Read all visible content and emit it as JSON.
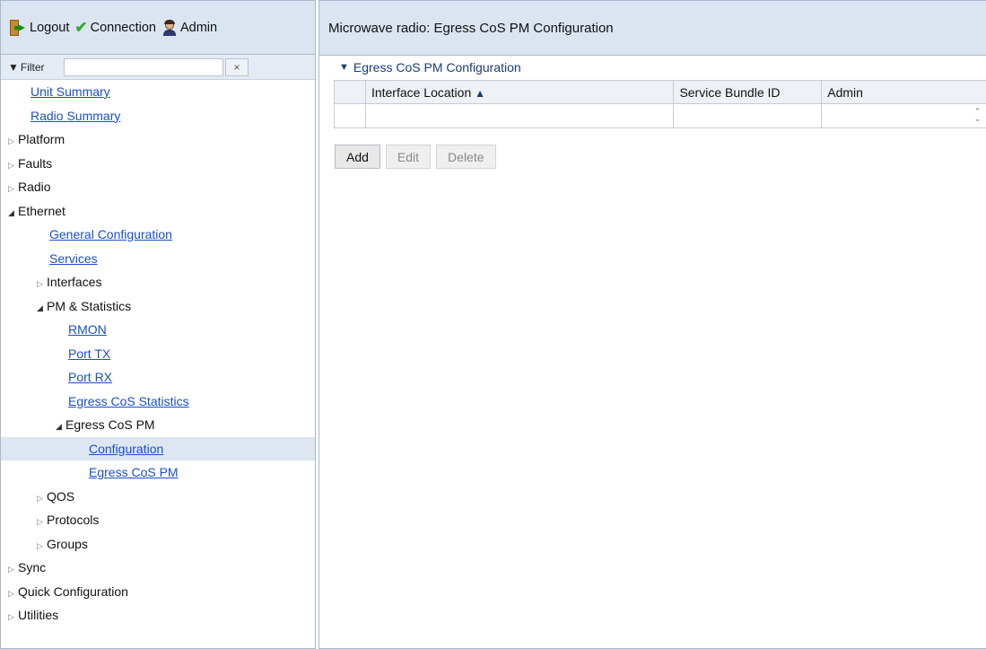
{
  "top_bar": {
    "logout_label": "Logout",
    "connection_label": "Connection",
    "admin_label": "Admin"
  },
  "filter": {
    "label": "Filter",
    "value": "",
    "placeholder": "",
    "clear_label": "×"
  },
  "nav": {
    "unit_summary": "Unit Summary",
    "radio_summary": "Radio Summary",
    "platform": "Platform",
    "faults": "Faults",
    "radio": "Radio",
    "ethernet": "Ethernet",
    "general_configuration": "General Configuration",
    "services": "Services",
    "interfaces": "Interfaces",
    "pm_statistics": "PM & Statistics",
    "rmon": "RMON",
    "port_tx": "Port TX",
    "port_rx": "Port RX",
    "egress_cos_statistics": "Egress CoS Statistics",
    "egress_cos_pm": "Egress CoS PM",
    "configuration": "Configuration",
    "egress_cos_pm_child": "Egress CoS PM",
    "qos": "QOS",
    "protocols": "Protocols",
    "groups": "Groups",
    "sync": "Sync",
    "quick_configuration": "Quick Configuration",
    "utilities": "Utilities"
  },
  "main": {
    "header_title": "Microwave radio: Egress CoS PM Configuration",
    "section_title": "Egress CoS PM Configuration",
    "table": {
      "columns": [
        "Interface Location",
        "Service Bundle ID",
        "Admin"
      ],
      "sort_indicator": "▲",
      "rows": [
        [
          "",
          "",
          ""
        ]
      ]
    },
    "buttons": {
      "add": "Add",
      "edit": "Edit",
      "delete": "Delete"
    }
  },
  "colors": {
    "header_bg": "#dbe5f1",
    "link": "#1a4fcc",
    "selected_row": "#dde6f1"
  }
}
